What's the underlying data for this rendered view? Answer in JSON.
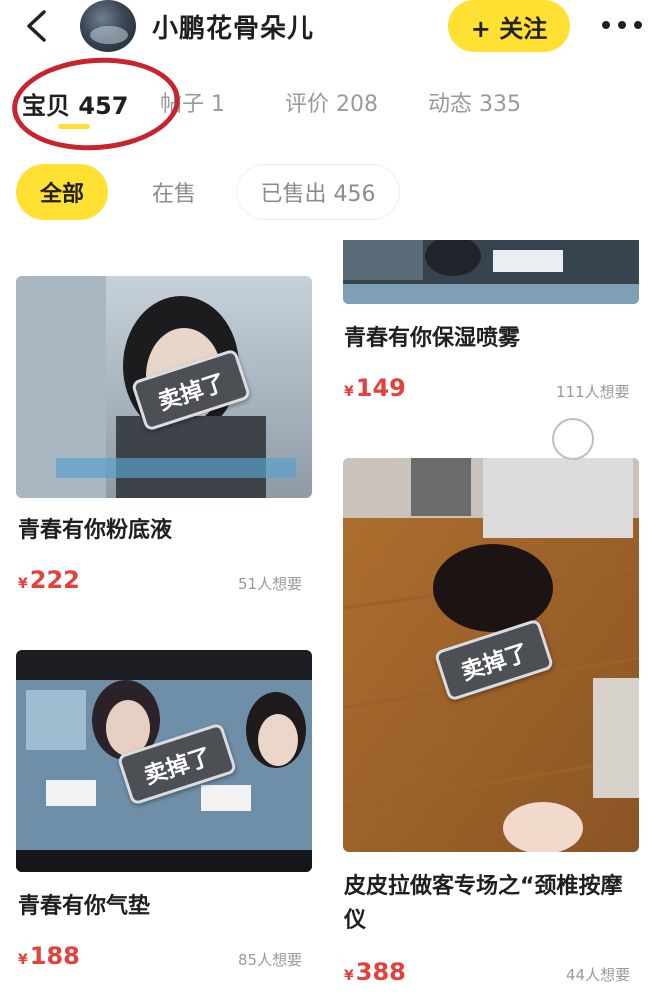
{
  "header": {
    "back_icon": "back-arrow-icon",
    "shop_name": "小鹏花骨朵儿",
    "follow_label": "+ 关注",
    "more_icon": "more-dots-icon"
  },
  "tabs": [
    {
      "label": "宝贝 457",
      "active": true
    },
    {
      "label": "帖子 1",
      "active": false
    },
    {
      "label": "评价 208",
      "active": false
    },
    {
      "label": "动态 335",
      "active": false
    }
  ],
  "chips": [
    {
      "label": "全部",
      "active": true
    },
    {
      "label": "在售",
      "active": false
    },
    {
      "label": "已售出 456",
      "active": false
    }
  ],
  "products": [
    {
      "title": "青春有你粉底液",
      "currency": "¥",
      "price": "222",
      "wants": "51人想要",
      "tag": "卖掉了"
    },
    {
      "title": "青春有你气垫",
      "currency": "¥",
      "price": "188",
      "wants": "85人想要",
      "tag": "卖掉了"
    },
    {
      "title": "青春有你保湿喷雾",
      "currency": "¥",
      "price": "149",
      "wants": "111人想要",
      "tag": ""
    },
    {
      "title": "皮皮拉做客专场之“颈椎按摩仪",
      "currency": "¥",
      "price": "388",
      "wants": "44人想要",
      "tag": "卖掉了"
    }
  ],
  "colors": {
    "accent": "#ffe033",
    "price": "#e3413b",
    "annotation": "#c8232f"
  }
}
